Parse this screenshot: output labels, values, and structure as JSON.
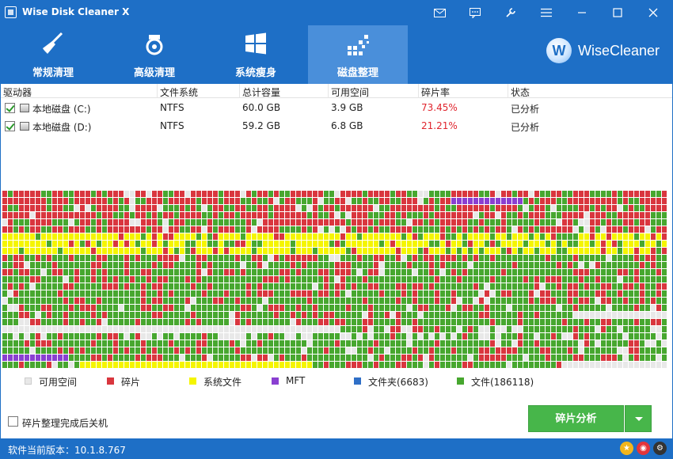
{
  "window": {
    "title": "Wise Disk Cleaner X",
    "controls": [
      "mail-icon",
      "chat-icon",
      "tools-icon",
      "menu-icon",
      "minimize-icon",
      "maximize-icon",
      "close-icon"
    ]
  },
  "nav": {
    "tabs": [
      {
        "label": "常规清理",
        "icon": "broom-icon"
      },
      {
        "label": "高级清理",
        "icon": "vacuum-icon"
      },
      {
        "label": "系统瘦身",
        "icon": "windows-icon"
      },
      {
        "label": "磁盘整理",
        "icon": "defrag-icon",
        "active": true
      }
    ],
    "brand": "WiseCleaner",
    "brand_letter": "W"
  },
  "drives": {
    "columns": [
      "驱动器",
      "文件系统",
      "总计容量",
      "可用空间",
      "碎片率",
      "状态"
    ],
    "rows": [
      {
        "checked": true,
        "name": "本地磁盘 (C:)",
        "fs": "NTFS",
        "total": "60.0 GB",
        "free": "3.9 GB",
        "frag": "73.45%",
        "status": "已分析"
      },
      {
        "checked": true,
        "name": "本地磁盘 (D:)",
        "fs": "NTFS",
        "total": "59.2 GB",
        "free": "6.8 GB",
        "frag": "21.21%",
        "status": "已分析"
      }
    ]
  },
  "legend": [
    {
      "label": "可用空间",
      "color": "#e8e8e8"
    },
    {
      "label": "碎片",
      "color": "#d9363e"
    },
    {
      "label": "系统文件",
      "color": "#f5f500"
    },
    {
      "label": "MFT",
      "color": "#8a3fd1"
    },
    {
      "label": "文件夹(6683)",
      "color": "#2f6fc7"
    },
    {
      "label": "文件(186118)",
      "color": "#47a72f"
    }
  ],
  "options": {
    "shutdown_label": "碎片整理完成后关机",
    "shutdown_checked": false
  },
  "actions": {
    "analyze_label": "碎片分析"
  },
  "status": {
    "version": "软件当前版本：10.1.8.767"
  },
  "colors": {
    "primary": "#1e6fc6",
    "active_tab": "#4a8fda",
    "frag_text": "#e0242d",
    "button": "#47b64a"
  }
}
